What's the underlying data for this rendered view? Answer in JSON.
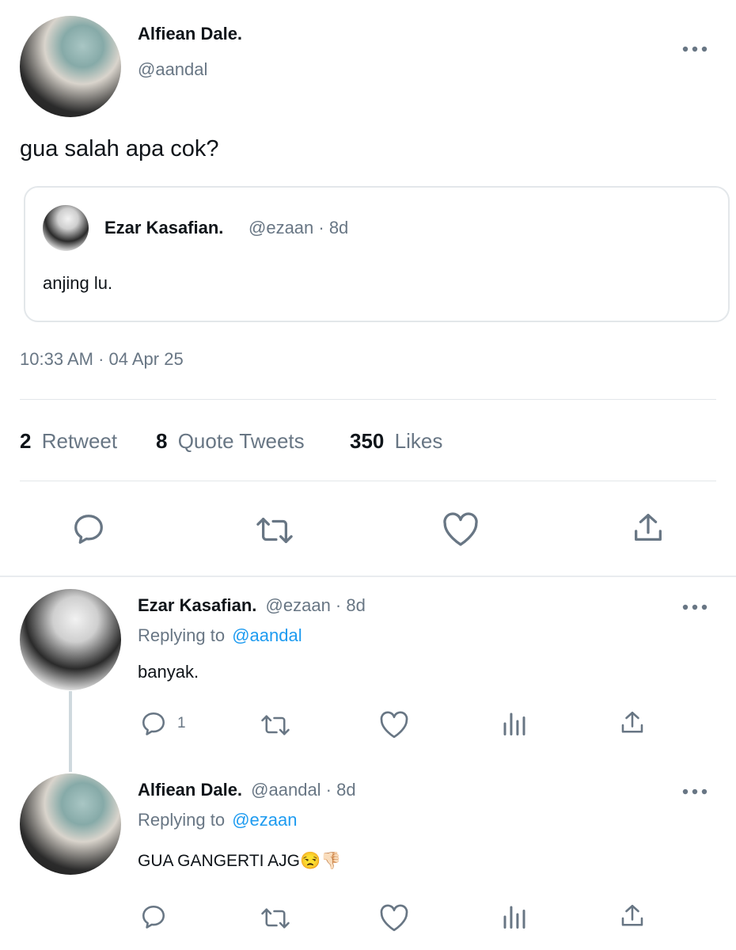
{
  "main_tweet": {
    "author_name": "Alfiean Dale.",
    "author_handle": "@aandal",
    "text": "gua salah apa cok?",
    "quoted": {
      "author_name": "Ezar Kasafian.",
      "meta": "@ezaan · 8d",
      "text": "anjing lu."
    },
    "timestamp": "10:33 AM · 04 Apr 25",
    "stats": {
      "retweets_count": "2",
      "retweets_label": "Retweet",
      "quotes_count": "8",
      "quotes_label": "Quote Tweets",
      "likes_count": "350",
      "likes_label": "Likes"
    }
  },
  "replies": [
    {
      "author_name": "Ezar Kasafian.",
      "meta": "@ezaan · 8d",
      "replying_prefix": "Replying to",
      "replying_handle": "@aandal",
      "text": "banyak.",
      "reply_count": "1"
    },
    {
      "author_name": "Alfiean Dale.",
      "meta": "@aandal · 8d",
      "replying_prefix": "Replying to",
      "replying_handle": "@ezaan",
      "text": "GUA GANGERTI AJG😒👎🏻",
      "reply_count": ""
    }
  ],
  "colors": {
    "link": "#1d9bf0",
    "muted": "#687684",
    "text": "#0f1419"
  }
}
